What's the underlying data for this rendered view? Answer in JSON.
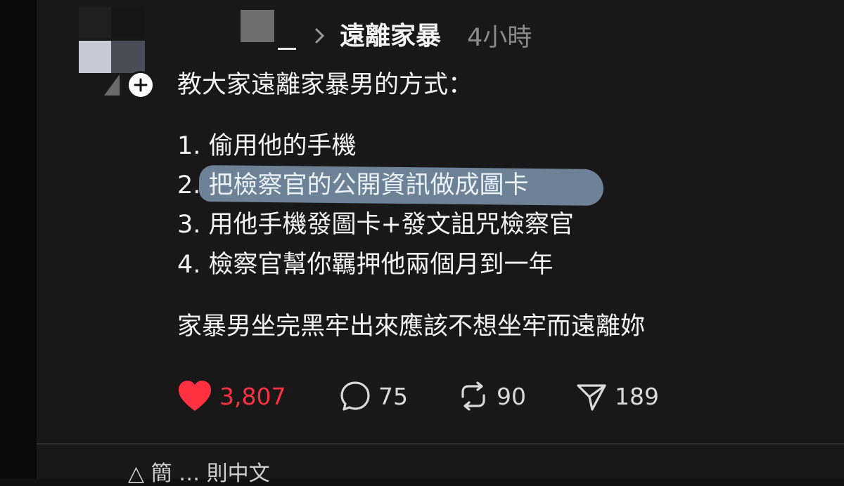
{
  "post": {
    "tag": "遠離家暴",
    "time": "4小時",
    "intro": "教大家遠離家暴男的方式：",
    "steps": [
      "1. 偷用他的手機",
      "2. ",
      "3. 用他手機發圖卡+發文詛咒檢察官",
      "4. 檢察官幫你羈押他兩個月到一年"
    ],
    "highlighted_step": "把檢察官的公開資訊做成圖卡",
    "conclusion": "家暴男坐完黑牢出來應該不想坐牢而遠離妳"
  },
  "actions": {
    "likes": "3,807",
    "comments": "75",
    "reposts": "90",
    "shares": "189"
  },
  "colors": {
    "background": "#181818",
    "like_red": "#ff3040",
    "highlight_blue": "#7d95ad",
    "muted_text": "#8a8a8a"
  },
  "icons": [
    "avatar",
    "plus-icon",
    "chevron-right-icon",
    "heart-icon",
    "comment-icon",
    "repost-icon",
    "share-icon"
  ],
  "next_preview": "△ 簡 … 則中文"
}
